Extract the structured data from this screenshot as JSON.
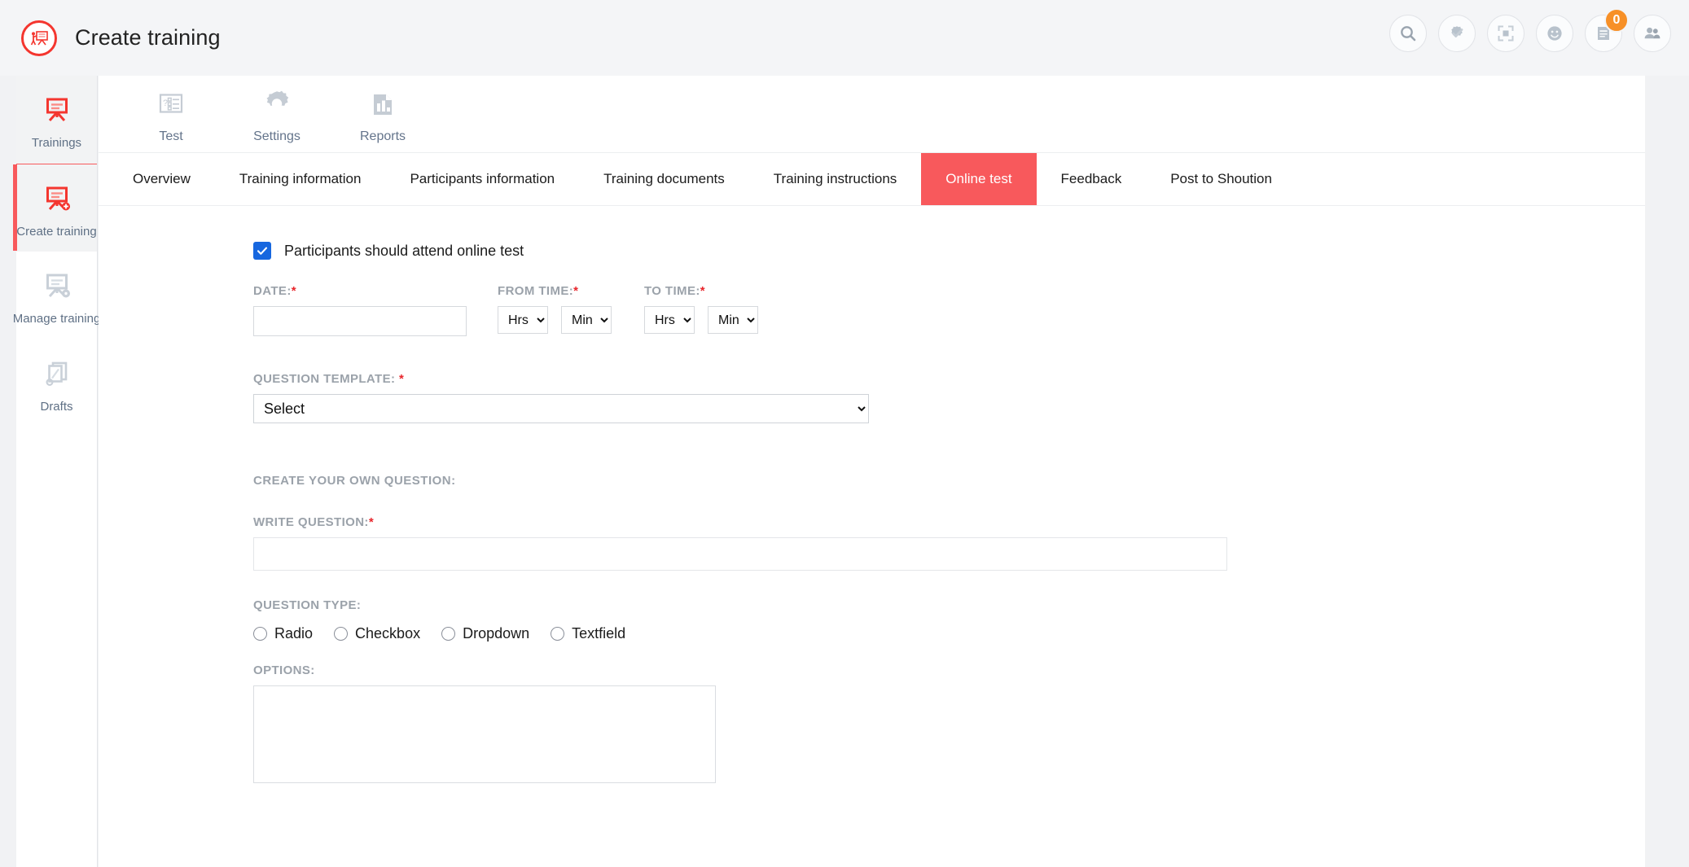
{
  "header": {
    "title": "Create training",
    "logo_icon": "training-easel-logo-icon",
    "actions": [
      {
        "name": "search-icon",
        "label": "Search"
      },
      {
        "name": "gear-check-icon",
        "label": "Approvals"
      },
      {
        "name": "fullscreen-icon",
        "label": "Fullscreen"
      },
      {
        "name": "smiley-icon",
        "label": "Mood"
      },
      {
        "name": "notes-icon",
        "label": "Notifications",
        "badge": "0"
      },
      {
        "name": "people-icon",
        "label": "Team"
      }
    ]
  },
  "loading_bar": {
    "visible": true,
    "color": "#f8595c"
  },
  "sidebar": {
    "items": [
      {
        "label": "Trainings",
        "icon": "easel-icon",
        "state": "hover"
      },
      {
        "label": "Create training",
        "icon": "easel-plus-icon",
        "state": "active"
      },
      {
        "label": "Manage training",
        "icon": "easel-gear-icon",
        "state": "normal"
      },
      {
        "label": "Drafts",
        "icon": "draft-pencil-icon",
        "state": "normal"
      }
    ]
  },
  "subtoolbar": {
    "items": [
      {
        "label": "Test",
        "icon": "quiz-list-icon"
      },
      {
        "label": "Settings",
        "icon": "gear-icon"
      },
      {
        "label": "Reports",
        "icon": "bar-chart-document-icon"
      }
    ]
  },
  "tabs": {
    "items": [
      {
        "label": "Overview",
        "active": false
      },
      {
        "label": "Training information",
        "active": false
      },
      {
        "label": "Participants information",
        "active": false
      },
      {
        "label": "Training documents",
        "active": false
      },
      {
        "label": "Training instructions",
        "active": false
      },
      {
        "label": "Online test",
        "active": true
      },
      {
        "label": "Feedback",
        "active": false
      },
      {
        "label": "Post to Shoution",
        "active": false
      }
    ],
    "active_color": "#f8595c"
  },
  "form": {
    "attend_checkbox": {
      "label": "Participants should attend online test",
      "checked": true,
      "color": "#1767df"
    },
    "date": {
      "label": "DATE:",
      "required": "*",
      "value": "",
      "placeholder": ""
    },
    "from_time": {
      "label": "FROM TIME:",
      "required": "*",
      "hours": "Hrs",
      "minutes": "Min"
    },
    "to_time": {
      "label": "TO TIME:",
      "required": "*",
      "hours": "Hrs",
      "minutes": "Min"
    },
    "question_template": {
      "label": "QUESTION TEMPLATE:",
      "required": "*",
      "selected": "Select"
    },
    "create_own_question": {
      "label": "CREATE YOUR OWN QUESTION:"
    },
    "write_question": {
      "label": "WRITE QUESTION:",
      "required": "*",
      "value": "",
      "placeholder": ""
    },
    "question_type": {
      "label": "QUESTION TYPE:",
      "options": [
        {
          "label": "Radio",
          "selected": false
        },
        {
          "label": "Checkbox",
          "selected": false
        },
        {
          "label": "Dropdown",
          "selected": false
        },
        {
          "label": "Textfield",
          "selected": false
        }
      ]
    },
    "options": {
      "label": "OPTIONS:",
      "value": "",
      "placeholder": ""
    }
  }
}
